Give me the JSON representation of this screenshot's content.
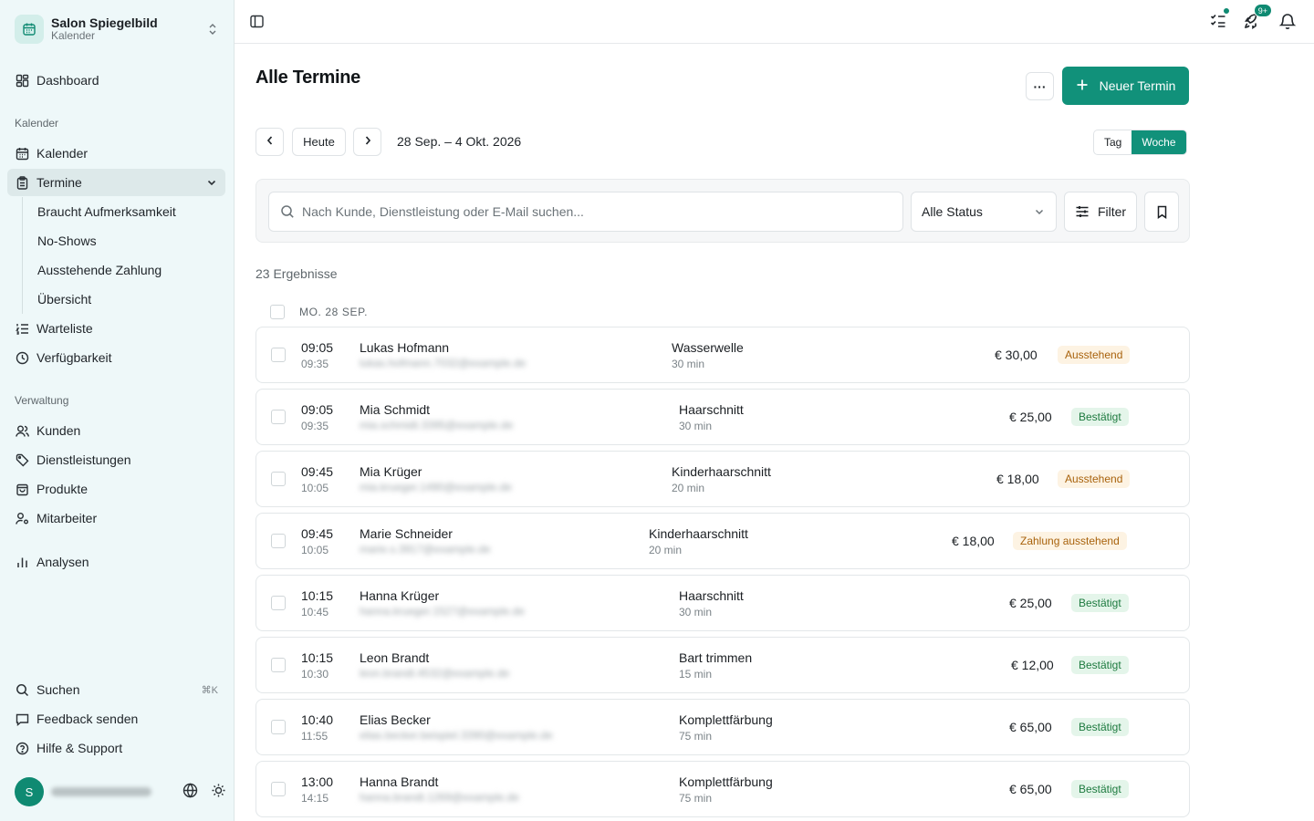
{
  "sidebar": {
    "org_name": "Salon Spiegelbild",
    "org_sub": "Kalender",
    "dashboard": "Dashboard",
    "section_calendar": "Kalender",
    "calendar": "Kalender",
    "appointments": "Termine",
    "sub_items": [
      "Braucht Aufmerksamkeit",
      "No-Shows",
      "Ausstehende Zahlung",
      "Übersicht"
    ],
    "waitlist": "Warteliste",
    "availability": "Verfügbarkeit",
    "section_admin": "Verwaltung",
    "customers": "Kunden",
    "services": "Dienstleistungen",
    "products": "Produkte",
    "staff": "Mitarbeiter",
    "analytics": "Analysen",
    "search": "Suchen",
    "search_shortcut": "⌘K",
    "feedback": "Feedback senden",
    "help": "Hilfe & Support",
    "avatar_initial": "S"
  },
  "topbar": {
    "notifications_badge": "9+"
  },
  "main": {
    "title": "Alle Termine",
    "more_label": "···",
    "new_button": "Neuer Termin",
    "today": "Heute",
    "date_range": "28 Sep. – 4 Okt. 2026",
    "view_day": "Tag",
    "view_week": "Woche",
    "search_placeholder": "Nach Kunde, Dienstleistung oder E-Mail suchen...",
    "status_select": "Alle Status",
    "filter_button": "Filter",
    "result_count": "23 Ergebnisse",
    "day_label": "MO. 28 SEP."
  },
  "appointments": [
    {
      "start": "09:05",
      "end": "09:35",
      "name": "Lukas Hofmann",
      "email": "lukas.hofmann.7032@example.de",
      "service": "Wasserwelle",
      "duration": "30 min",
      "price": "€ 30,00",
      "status": "Ausstehend",
      "status_type": "pending"
    },
    {
      "start": "09:05",
      "end": "09:35",
      "name": "Mia Schmidt",
      "email": "mia.schmidt.3395@example.de",
      "service": "Haarschnitt",
      "duration": "30 min",
      "price": "€ 25,00",
      "status": "Bestätigt",
      "status_type": "ok"
    },
    {
      "start": "09:45",
      "end": "10:05",
      "name": "Mia Krüger",
      "email": "mia.krueger.1490@example.de",
      "service": "Kinderhaarschnitt",
      "duration": "20 min",
      "price": "€ 18,00",
      "status": "Ausstehend",
      "status_type": "pending"
    },
    {
      "start": "09:45",
      "end": "10:05",
      "name": "Marie Schneider",
      "email": "marie.s.3917@example.de",
      "service": "Kinderhaarschnitt",
      "duration": "20 min",
      "price": "€ 18,00",
      "status": "Zahlung ausstehend",
      "status_type": "pending"
    },
    {
      "start": "10:15",
      "end": "10:45",
      "name": "Hanna Krüger",
      "email": "hanna.krueger.1527@example.de",
      "service": "Haarschnitt",
      "duration": "30 min",
      "price": "€ 25,00",
      "status": "Bestätigt",
      "status_type": "ok"
    },
    {
      "start": "10:15",
      "end": "10:30",
      "name": "Leon Brandt",
      "email": "leon.brandt.4532@example.de",
      "service": "Bart trimmen",
      "duration": "15 min",
      "price": "€ 12,00",
      "status": "Bestätigt",
      "status_type": "ok"
    },
    {
      "start": "10:40",
      "end": "11:55",
      "name": "Elias Becker",
      "email": "elias.becker.beispiel.3390@example.de",
      "service": "Komplettfärbung",
      "duration": "75 min",
      "price": "€ 65,00",
      "status": "Bestätigt",
      "status_type": "ok"
    },
    {
      "start": "13:00",
      "end": "14:15",
      "name": "Hanna Brandt",
      "email": "hanna.brandt.1269@example.de",
      "service": "Komplettfärbung",
      "duration": "75 min",
      "price": "€ 65,00",
      "status": "Bestätigt",
      "status_type": "ok"
    }
  ]
}
